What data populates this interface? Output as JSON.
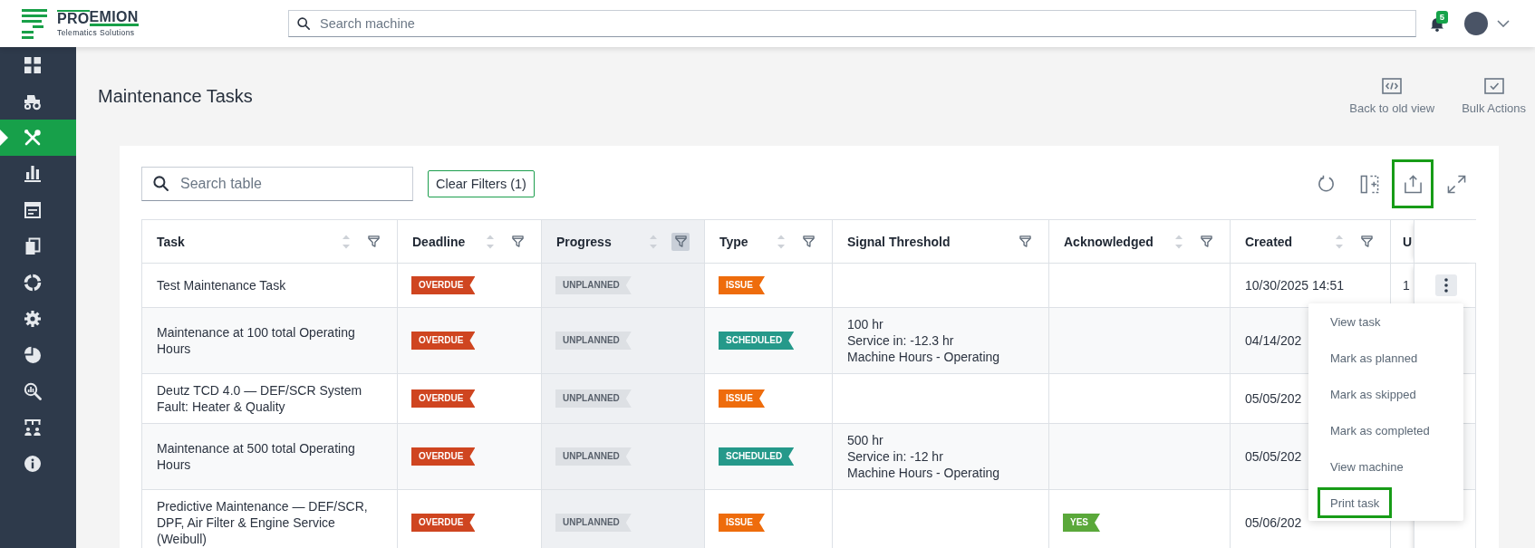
{
  "header": {
    "logo": {
      "wordmark": [
        "PRO",
        "EMION"
      ],
      "tagline": "Telematics Solutions"
    },
    "search": {
      "placeholder": "Search machine"
    },
    "notifications": {
      "count": "5"
    }
  },
  "sidebar": {
    "items": [
      {
        "selected": false
      },
      {
        "selected": false
      },
      {
        "selected": true
      },
      {
        "selected": false
      },
      {
        "selected": false
      },
      {
        "selected": false
      },
      {
        "selected": false
      },
      {
        "selected": false
      },
      {
        "selected": false
      },
      {
        "selected": false
      },
      {
        "selected": false
      },
      {
        "selected": false
      }
    ]
  },
  "page": {
    "title": "Maintenance Tasks",
    "actions": [
      {
        "label": "Back to old view"
      },
      {
        "label": "Bulk Actions"
      }
    ]
  },
  "toolbar": {
    "search": {
      "placeholder": "Search table"
    },
    "clear_filters": "Clear Filters (1)",
    "tools": [
      {
        "highlighted": false
      },
      {
        "highlighted": false
      },
      {
        "highlighted": true
      },
      {
        "highlighted": false
      }
    ]
  },
  "table": {
    "columns": [
      {
        "label": "Task",
        "sortable": true,
        "filterable": true,
        "filter_active": false
      },
      {
        "label": "Deadline",
        "sortable": true,
        "filterable": true,
        "filter_active": false
      },
      {
        "label": "Progress",
        "sortable": true,
        "filterable": true,
        "filter_active": true
      },
      {
        "label": "Type",
        "sortable": true,
        "filterable": true,
        "filter_active": false
      },
      {
        "label": "Signal Threshold",
        "sortable": false,
        "filterable": true,
        "filter_active": false
      },
      {
        "label": "Acknowledged",
        "sortable": true,
        "filterable": true,
        "filter_active": false
      },
      {
        "label": "Created",
        "sortable": true,
        "filterable": true,
        "filter_active": false
      },
      {
        "label": "U"
      }
    ],
    "rows": [
      {
        "task": "Test Maintenance Task",
        "deadline": {
          "label": "OVERDUE",
          "color": "#cf4520"
        },
        "progress": {
          "label": "UNPLANNED",
          "color": "#dde0e4"
        },
        "type": {
          "label": "ISSUE",
          "color": "#ee6c0c"
        },
        "created": "10/30/2025 14:51",
        "column_8": "1",
        "menu_button": true
      },
      {
        "task": "Maintenance at 100 total Operating Hours",
        "deadline": {
          "label": "OVERDUE",
          "color": "#cf4520"
        },
        "progress": {
          "label": "UNPLANNED",
          "color": "#dde0e4"
        },
        "type": {
          "label": "SCHEDULED",
          "color": "#25998a"
        },
        "signal_threshold": [
          "100 hr",
          "Service in: -12.3 hr",
          "Machine Hours - Operating"
        ],
        "created": "04/14/202",
        "menu_button": false
      },
      {
        "task": "Deutz TCD 4.0 — DEF/SCR System Fault: Heater & Quality",
        "deadline": {
          "label": "OVERDUE",
          "color": "#cf4520"
        },
        "progress": {
          "label": "UNPLANNED",
          "color": "#dde0e4"
        },
        "type": {
          "label": "ISSUE",
          "color": "#ee6c0c"
        },
        "created": "05/05/202",
        "menu_button": false
      },
      {
        "task": "Maintenance at 500 total Operating Hours",
        "deadline": {
          "label": "OVERDUE",
          "color": "#cf4520"
        },
        "progress": {
          "label": "UNPLANNED",
          "color": "#dde0e4"
        },
        "type": {
          "label": "SCHEDULED",
          "color": "#25998a"
        },
        "signal_threshold": [
          "500 hr",
          "Service in: -12 hr",
          "Machine Hours - Operating"
        ],
        "created": "05/05/202",
        "menu_button": false
      },
      {
        "task": "Predictive Maintenance — DEF/SCR, DPF, Air Filter & Engine Service (Weibull)",
        "deadline": {
          "label": "OVERDUE",
          "color": "#cf4520"
        },
        "progress": {
          "label": "UNPLANNED",
          "color": "#dde0e4"
        },
        "type": {
          "label": "ISSUE",
          "color": "#ee6c0c"
        },
        "acknowledged": {
          "label": "YES",
          "color": "#5aa83a"
        },
        "created": "05/06/202",
        "menu_button": false
      }
    ],
    "row_menu": {
      "items": [
        {
          "label": "View task",
          "highlighted": false
        },
        {
          "label": "Mark as planned",
          "highlighted": false
        },
        {
          "label": "Mark as skipped",
          "highlighted": false
        },
        {
          "label": "Mark as completed",
          "highlighted": false
        },
        {
          "label": "View machine",
          "highlighted": false
        },
        {
          "label": "Print task",
          "highlighted": true
        }
      ]
    }
  }
}
